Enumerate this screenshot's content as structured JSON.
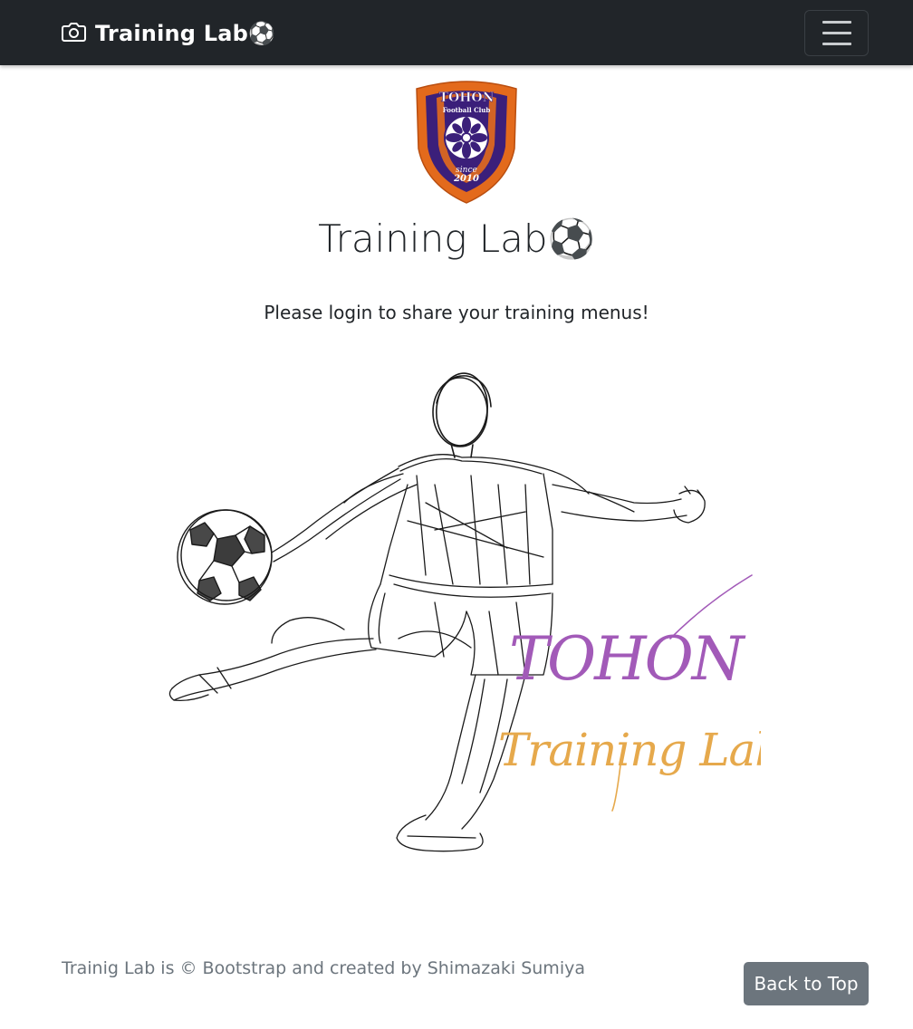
{
  "navbar": {
    "brand_label": "Training Lab⚽",
    "brand_icon": "camera-icon",
    "menu_icon": "hamburger-menu-icon"
  },
  "logo": {
    "top_text": "TOHON",
    "club_text": "Football Club",
    "since_text": "since",
    "year_text": "2010",
    "colors": {
      "outer": "#e36a1c",
      "inner": "#3b1f7a"
    }
  },
  "main": {
    "title": "Training Lab⚽",
    "login_prompt": "Please login to share your training menus!"
  },
  "hero": {
    "signature_line1": "TOHON",
    "signature_line2": "Training Lab",
    "colors": {
      "sketch": "#1a1a1a",
      "signature1": "#a25ab8",
      "signature2": "#e6a94c"
    }
  },
  "footer": {
    "credit_text": "Trainig Lab is © Bootstrap and created by Shimazaki Sumiya",
    "back_to_top_label": "Back to Top"
  },
  "colors": {
    "navbar_bg": "#212529",
    "text": "#212529",
    "muted": "#6c757d",
    "button_bg": "#6c757d"
  }
}
